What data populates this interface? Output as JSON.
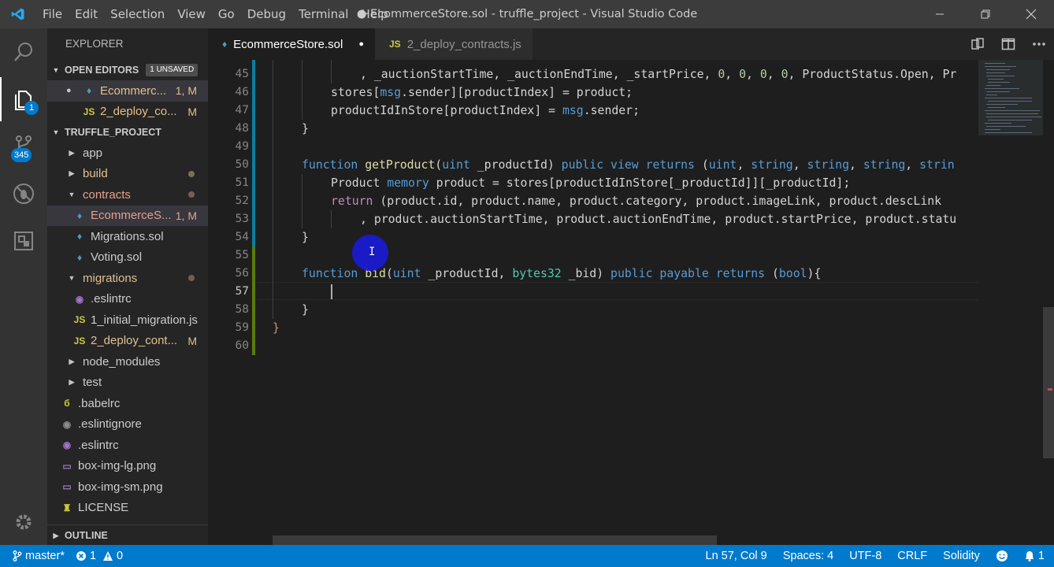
{
  "titlebar": {
    "menu": [
      "File",
      "Edit",
      "Selection",
      "View",
      "Go",
      "Debug",
      "Terminal",
      "Help"
    ],
    "title": "● EcommerceStore.sol - truffle_project - Visual Studio Code"
  },
  "activitybar": {
    "explorer_badge": "1",
    "scm_badge": "345"
  },
  "sidebar": {
    "title": "EXPLORER",
    "open_editors": {
      "header": "OPEN EDITORS",
      "badge": "1 UNSAVED",
      "items": [
        {
          "label": "Ecommerc...",
          "status": "1, M"
        },
        {
          "label": "2_deploy_co...",
          "status": "M"
        }
      ]
    },
    "project": {
      "header": "TRUFFLE_PROJECT",
      "items": [
        {
          "label": "app",
          "status": ""
        },
        {
          "label": "build",
          "status": ""
        },
        {
          "label": "contracts",
          "status": ""
        },
        {
          "label": "EcommerceS...",
          "status": "1, M"
        },
        {
          "label": "Migrations.sol",
          "status": ""
        },
        {
          "label": "Voting.sol",
          "status": ""
        },
        {
          "label": "migrations",
          "status": ""
        },
        {
          "label": ".eslintrc",
          "status": ""
        },
        {
          "label": "1_initial_migration.js",
          "status": ""
        },
        {
          "label": "2_deploy_cont...",
          "status": "M"
        },
        {
          "label": "node_modules",
          "status": ""
        },
        {
          "label": "test",
          "status": ""
        },
        {
          "label": ".babelrc",
          "status": ""
        },
        {
          "label": ".eslintignore",
          "status": ""
        },
        {
          "label": ".eslintrc",
          "status": ""
        },
        {
          "label": "box-img-lg.png",
          "status": ""
        },
        {
          "label": "box-img-sm.png",
          "status": ""
        },
        {
          "label": "LICENSE",
          "status": ""
        }
      ]
    },
    "outline_header": "OUTLINE"
  },
  "tabs": [
    {
      "label": "EcommerceStore.sol",
      "active": true,
      "dirty": true
    },
    {
      "label": "2_deploy_contracts.js",
      "active": false,
      "dirty": false
    }
  ],
  "file_icon_text": "JS",
  "editor": {
    "line_numbers": [
      "45",
      "46",
      "47",
      "48",
      "49",
      "50",
      "51",
      "52",
      "53",
      "54",
      "55",
      "56",
      "57",
      "58",
      "59",
      "60"
    ],
    "current_line": "57"
  },
  "statusbar": {
    "branch": "master*",
    "errors": "1",
    "warnings": "0",
    "position": "Ln 57, Col 9",
    "spaces": "Spaces: 4",
    "encoding": "UTF-8",
    "eol": "CRLF",
    "language": "Solidity",
    "notifications": "1"
  },
  "colors": {
    "statusbar": "#007acc",
    "sidebar": "#252526",
    "editor": "#1e1e1e",
    "activitybar": "#333333"
  }
}
